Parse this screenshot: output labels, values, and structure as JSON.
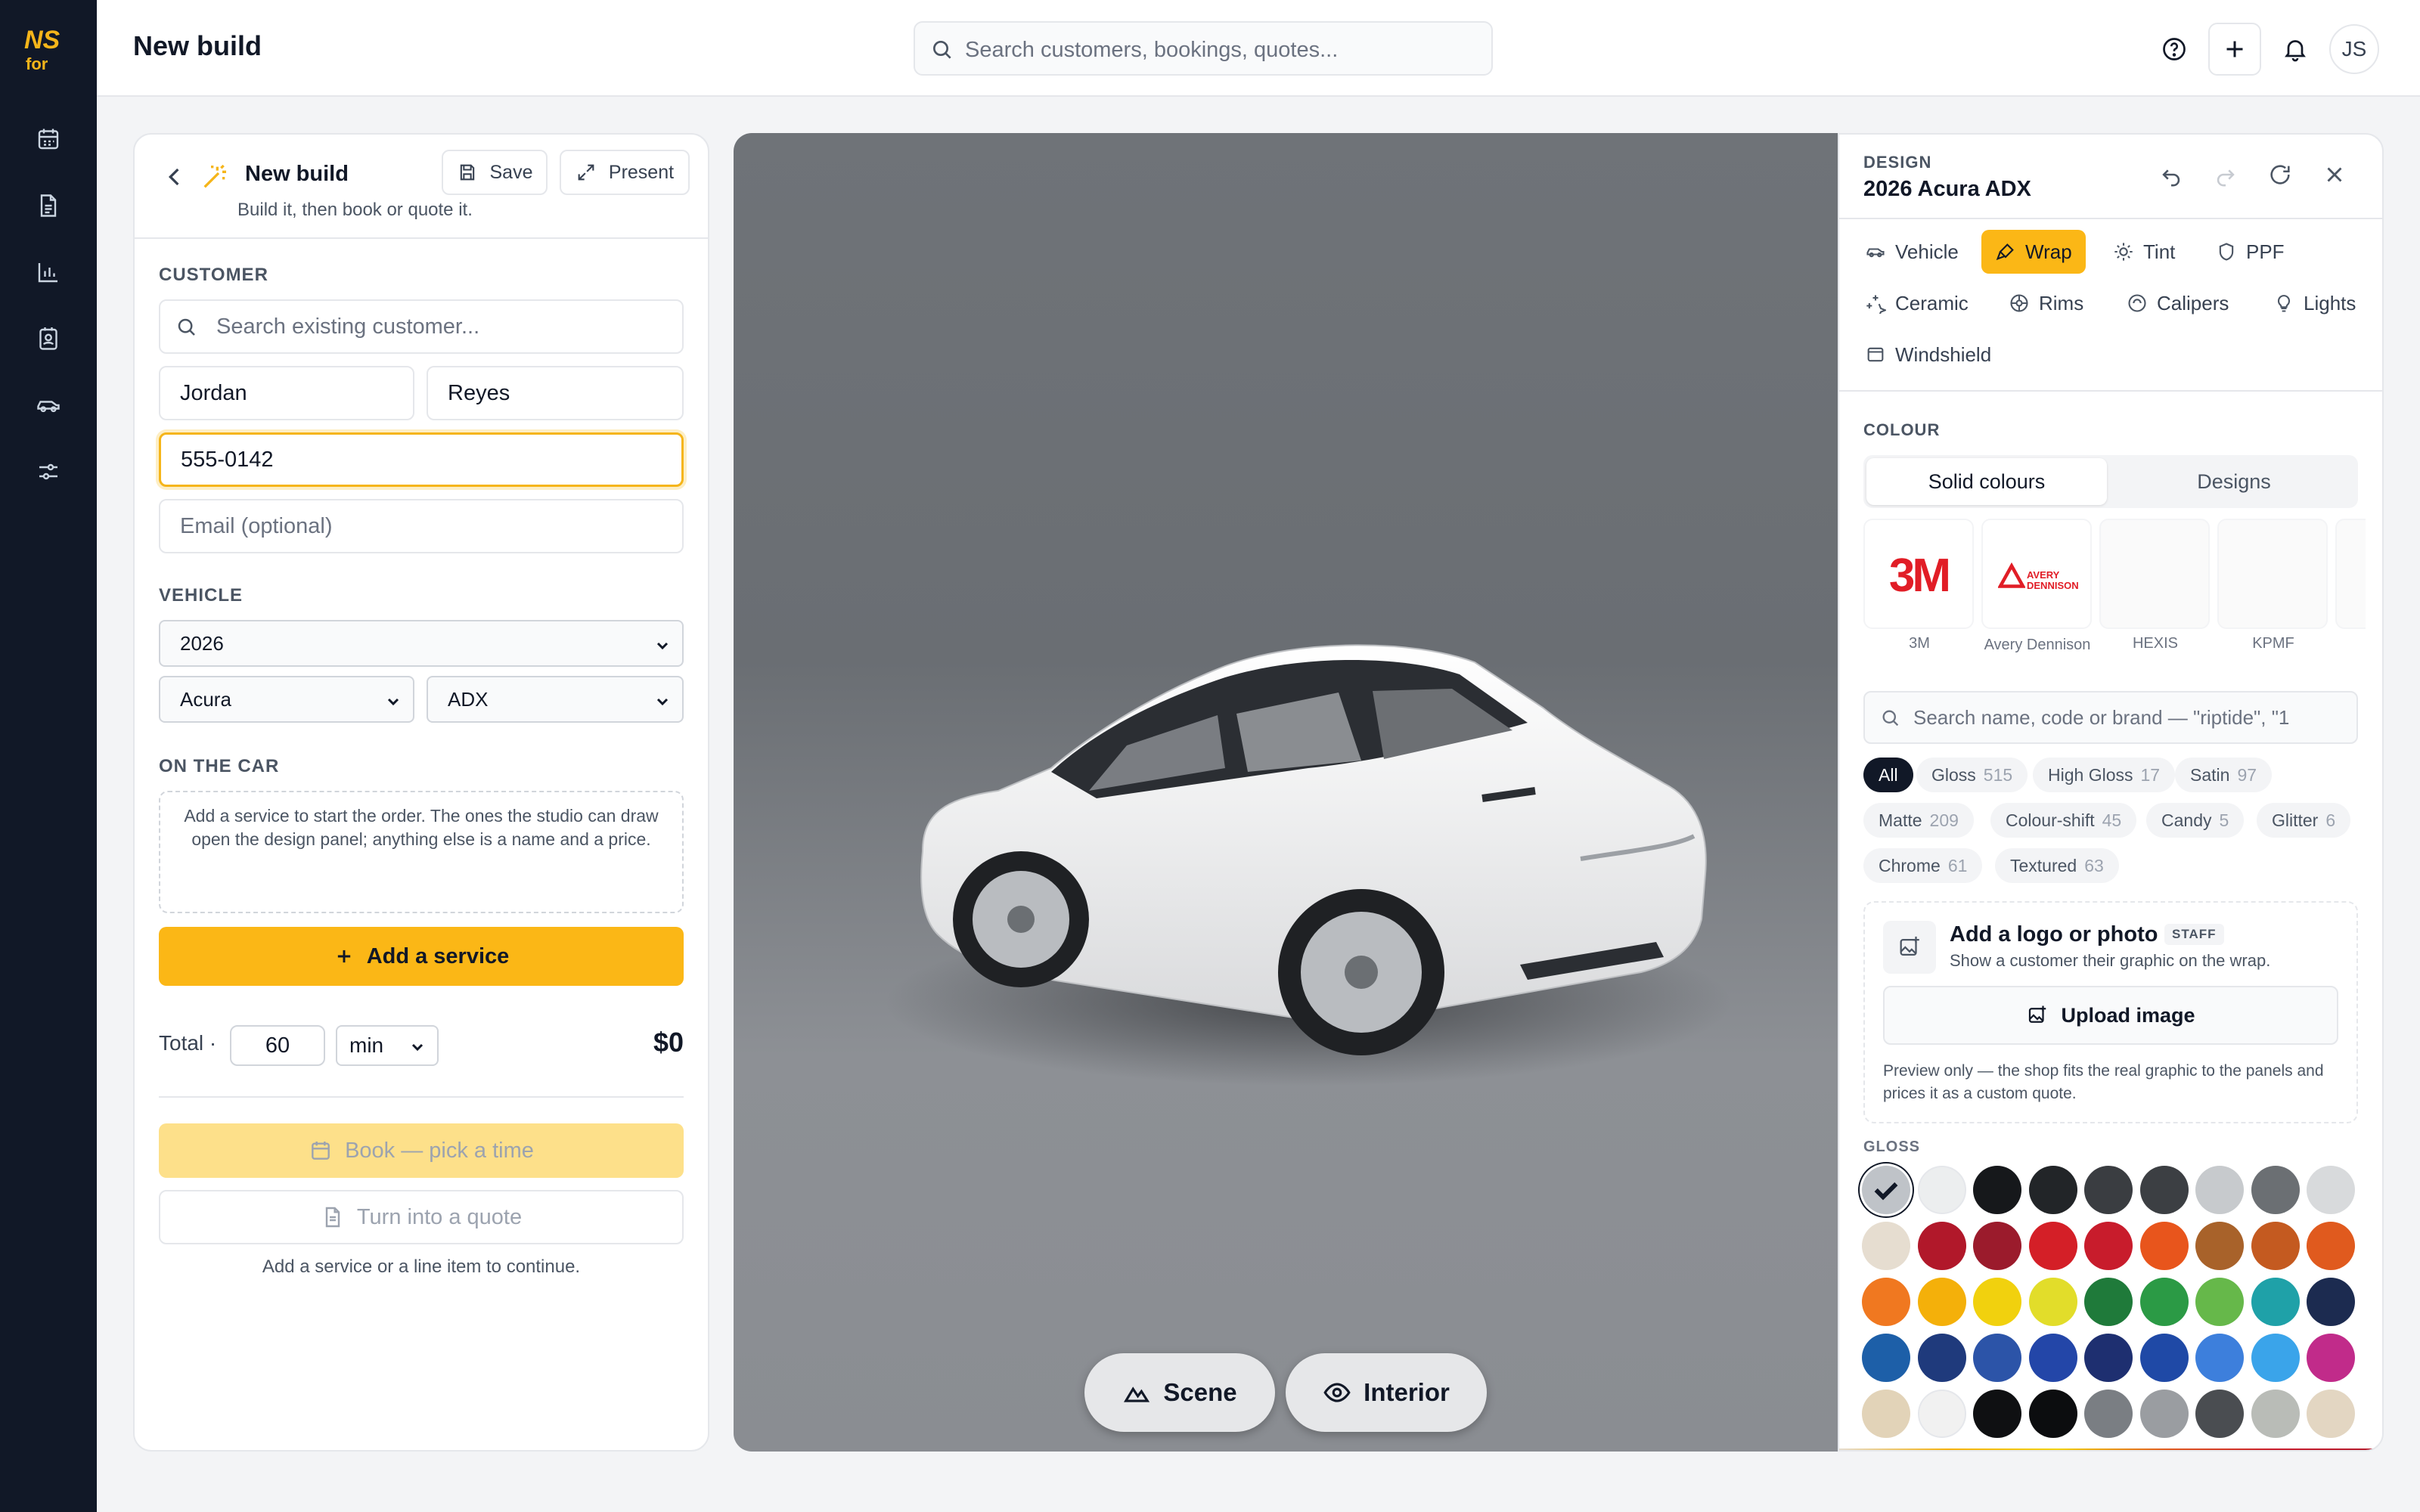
{
  "app": {
    "brand": "NSfor"
  },
  "header": {
    "title": "New build",
    "search_placeholder": "Search customers, bookings, quotes...",
    "avatar_initials": "JS"
  },
  "sidebar": {
    "items": [
      "calendar-icon",
      "document-icon",
      "chart-icon",
      "contacts-icon",
      "car-icon",
      "sliders-icon"
    ]
  },
  "build": {
    "title": "New build",
    "subtitle": "Build it, then book or quote it.",
    "save_label": "Save",
    "present_label": "Present",
    "customer_label": "CUSTOMER",
    "customer_search_placeholder": "Search existing customer...",
    "first_name": "Jordan",
    "last_name": "Reyes",
    "phone": "555-0142",
    "email_placeholder": "Email (optional)",
    "vehicle_label": "VEHICLE",
    "year": "2026",
    "make": "Acura",
    "model": "ADX",
    "on_car_label": "ON THE CAR",
    "on_car_hint": "Add a service to start the order. The ones the studio can draw open the design panel; anything else is a name and a price.",
    "add_service_label": "Add a service",
    "total_label": "Total ·",
    "duration": "60",
    "duration_unit": "min",
    "total_price": "$0",
    "book_label": "Book — pick a time",
    "quote_label": "Turn into a quote",
    "continue_hint": "Add a service or a line item to continue."
  },
  "viewer": {
    "scene_label": "Scene",
    "interior_label": "Interior",
    "car_color": "#ffffff"
  },
  "design": {
    "section_label": "DESIGN",
    "vehicle_name": "2026 Acura ADX",
    "tabs": [
      "Vehicle",
      "Wrap",
      "Tint",
      "PPF",
      "Ceramic",
      "Rims",
      "Calipers",
      "Lights",
      "Windshield"
    ],
    "active_tab": "Wrap",
    "colour_label": "COLOUR",
    "colour_tabs": [
      "Solid colours",
      "Designs"
    ],
    "brands": [
      {
        "logo": "3M",
        "name": "3M"
      },
      {
        "logo": "AVERY DENNISON",
        "name": "Avery Dennison"
      },
      {
        "logo": "",
        "name": "HEXIS"
      },
      {
        "logo": "",
        "name": "KPMF"
      }
    ],
    "search_placeholder": "Search name, code or brand — \"riptide\", \"1",
    "filters": [
      {
        "name": "All",
        "count": ""
      },
      {
        "name": "Gloss",
        "count": "515"
      },
      {
        "name": "High Gloss",
        "count": "17"
      },
      {
        "name": "Satin",
        "count": "97"
      },
      {
        "name": "Matte",
        "count": "209"
      },
      {
        "name": "Colour-shift",
        "count": "45"
      },
      {
        "name": "Candy",
        "count": "5"
      },
      {
        "name": "Glitter",
        "count": "6"
      },
      {
        "name": "Chrome",
        "count": "61"
      },
      {
        "name": "Textured",
        "count": "63"
      }
    ],
    "logo_title": "Add a logo or photo",
    "logo_badge": "STAFF",
    "logo_desc": "Show a customer their graphic on the wrap.",
    "upload_label": "Upload image",
    "logo_note": "Preview only — the shop fits the real graphic to the panels and prices it as a custom quote.",
    "gloss_label": "GLOSS",
    "swatches": [
      "#bfc3c8",
      "#eceeef",
      "#16181b",
      "#222528",
      "#3a3d41",
      "#3c3f43",
      "#c7cacd",
      "#6b6f73",
      "#d8dadc",
      "#e6ddd0",
      "#b1182a",
      "#9b1b2c",
      "#d41f27",
      "#c81c2c",
      "#e8551c",
      "#a8622a",
      "#c45a20",
      "#e05a1e",
      "#f07820",
      "#f4b00a",
      "#f1d10e",
      "#e2dd2a",
      "#1f7a3a",
      "#2b9a45",
      "#66b84a",
      "#1fa1a8",
      "#1c2b50",
      "#1d5fa8",
      "#1f3a7c",
      "#2c54a8",
      "#2346a8",
      "#1e2f70",
      "#1f49a6",
      "#3d7fdc",
      "#3aa4ea",
      "#c12b8a",
      "#e2d3b8",
      "#f1f1f1",
      "#0f1012",
      "#0c0d0f",
      "#7a7e83",
      "#9a9da1",
      "#4a4d51",
      "#b9bcb7",
      "#e3d6c2"
    ]
  }
}
